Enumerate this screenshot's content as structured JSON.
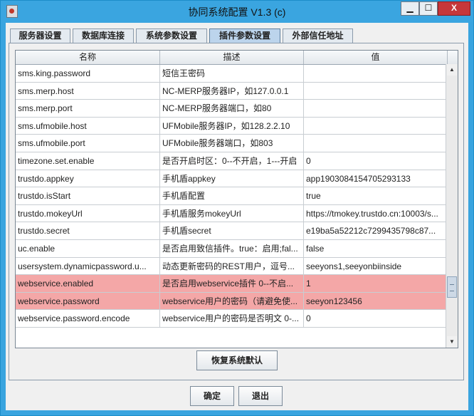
{
  "window": {
    "title": "协同系统配置 V1.3 (c)",
    "min_symbol": "▁",
    "max_symbol": "☐",
    "close_symbol": "X"
  },
  "tabs": [
    {
      "label": "服务器设置",
      "active": false
    },
    {
      "label": "数据库连接",
      "active": false
    },
    {
      "label": "系统参数设置",
      "active": false
    },
    {
      "label": "插件参数设置",
      "active": true
    },
    {
      "label": "外部信任地址",
      "active": false
    }
  ],
  "table": {
    "headers": [
      "名称",
      "描述",
      "值"
    ],
    "rows": [
      {
        "name": "sms.king.password",
        "desc": "短信王密码",
        "value": "",
        "highlight": false
      },
      {
        "name": "sms.merp.host",
        "desc": "NC-MERP服务器IP，如127.0.0.1",
        "value": "",
        "highlight": false
      },
      {
        "name": "sms.merp.port",
        "desc": "NC-MERP服务器端口，如80",
        "value": "",
        "highlight": false
      },
      {
        "name": "sms.ufmobile.host",
        "desc": "UFMobile服务器IP，如128.2.2.10",
        "value": "",
        "highlight": false
      },
      {
        "name": "sms.ufmobile.port",
        "desc": "UFMobile服务器端口，如803",
        "value": "",
        "highlight": false
      },
      {
        "name": "timezone.set.enable",
        "desc": "是否开启时区：0--不开启，1---开启",
        "value": "0",
        "highlight": false
      },
      {
        "name": "trustdo.appkey",
        "desc": "手机盾appkey",
        "value": "app1903084154705293133",
        "highlight": false
      },
      {
        "name": "trustdo.isStart",
        "desc": "手机盾配置",
        "value": "true",
        "highlight": false
      },
      {
        "name": "trustdo.mokeyUrl",
        "desc": "手机盾服务mokeyUrl",
        "value": "https://tmokey.trustdo.cn:10003/s...",
        "highlight": false
      },
      {
        "name": "trustdo.secret",
        "desc": "手机盾secret",
        "value": "e19ba5a52212c7299435798c87...",
        "highlight": false
      },
      {
        "name": "uc.enable",
        "desc": "是否启用致信插件。true：启用;fal...",
        "value": "false",
        "highlight": false
      },
      {
        "name": "usersystem.dynamicpassword.u...",
        "desc": "动态更新密码的REST用户，逗号...",
        "value": "seeyons1,seeyonbiinside",
        "highlight": false
      },
      {
        "name": "webservice.enabled",
        "desc": "是否启用webservice插件 0--不启...",
        "value": "1",
        "highlight": true
      },
      {
        "name": "webservice.password",
        "desc": "webservice用户的密码（请避免使...",
        "value": "seeyon123456",
        "highlight": true
      },
      {
        "name": "webservice.password.encode",
        "desc": "webservice用户的密码是否明文 0-...",
        "value": "0",
        "highlight": false
      }
    ],
    "highlight_color": "#f4a7a7"
  },
  "scroll": {
    "up_icon": "▲",
    "down_icon": "▼"
  },
  "buttons": {
    "restore": "恢复系统默认",
    "ok": "确定",
    "exit": "退出"
  }
}
